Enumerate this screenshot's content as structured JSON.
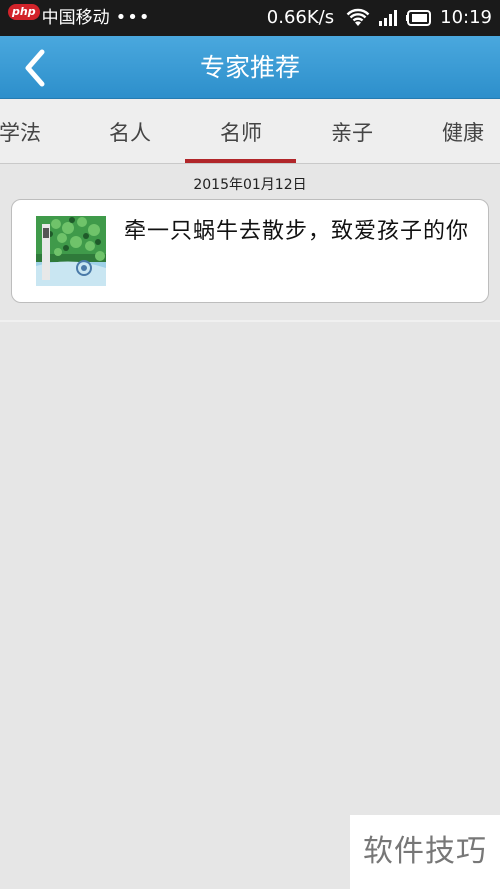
{
  "status_bar": {
    "carrier": "中国移动",
    "dots": "•••",
    "speed": "0.66K/s",
    "time": "10:19",
    "watermark_badge": "php"
  },
  "header": {
    "title": "专家推荐"
  },
  "tabs": [
    {
      "label": "学法"
    },
    {
      "label": "名人"
    },
    {
      "label": "名师"
    },
    {
      "label": "亲子"
    },
    {
      "label": "健康"
    }
  ],
  "active_tab": "名师",
  "list": {
    "date": "2015年01月12日",
    "items": [
      {
        "title": "牵一只蜗牛去散步，致爱孩子的你"
      }
    ]
  },
  "watermark": "软件技巧",
  "colors": {
    "header": "#3a9bd6",
    "tab_underline": "#b1262a",
    "background": "#e6e6e6"
  }
}
